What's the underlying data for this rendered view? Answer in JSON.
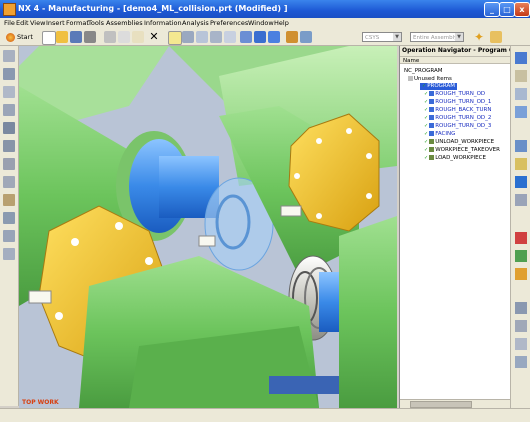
{
  "window": {
    "title": "NX 4 - Manufacturing - [demo4_ML_collision.prt (Modified) ]",
    "minimize": "_",
    "maximize": "□",
    "close": "x"
  },
  "menu": [
    "File",
    "Edit",
    "View",
    "Insert",
    "Format",
    "Tools",
    "Assemblies",
    "Information",
    "Analysis",
    "Preferences",
    "Window",
    "Help"
  ],
  "toolbar": {
    "start_label": "Start",
    "csys_combo": "CSYS",
    "assembly_combo": "Entire Assembly"
  },
  "viewport": {
    "label": "TOP WORK"
  },
  "navigator": {
    "title": "Operation Navigator - Program Order",
    "column_header": "Name",
    "root": "NC_PROGRAM",
    "unused": "Unused Items",
    "program": "PROGRAM",
    "operations": [
      {
        "name": "ROUGH_TURN_OD"
      },
      {
        "name": "ROUGH_TURN_OD_1"
      },
      {
        "name": "ROUGH_BACK_TURN"
      },
      {
        "name": "ROUGH_TURN_OD_2"
      },
      {
        "name": "ROUGH_TURN_OD_3"
      },
      {
        "name": "FACING"
      },
      {
        "name": "UNLOAD_WORKPIECE"
      },
      {
        "name": "WORKPIECE_TAKEOVER"
      },
      {
        "name": "LOAD_WORKPIECE"
      }
    ]
  },
  "colors": {
    "title_blue": "#1d58d4",
    "chuck_yellow": "#f0c418",
    "machine_green": "#86d07a",
    "workpiece_blue": "#3a8ae8",
    "selection_blue": "#2a5cd8"
  }
}
